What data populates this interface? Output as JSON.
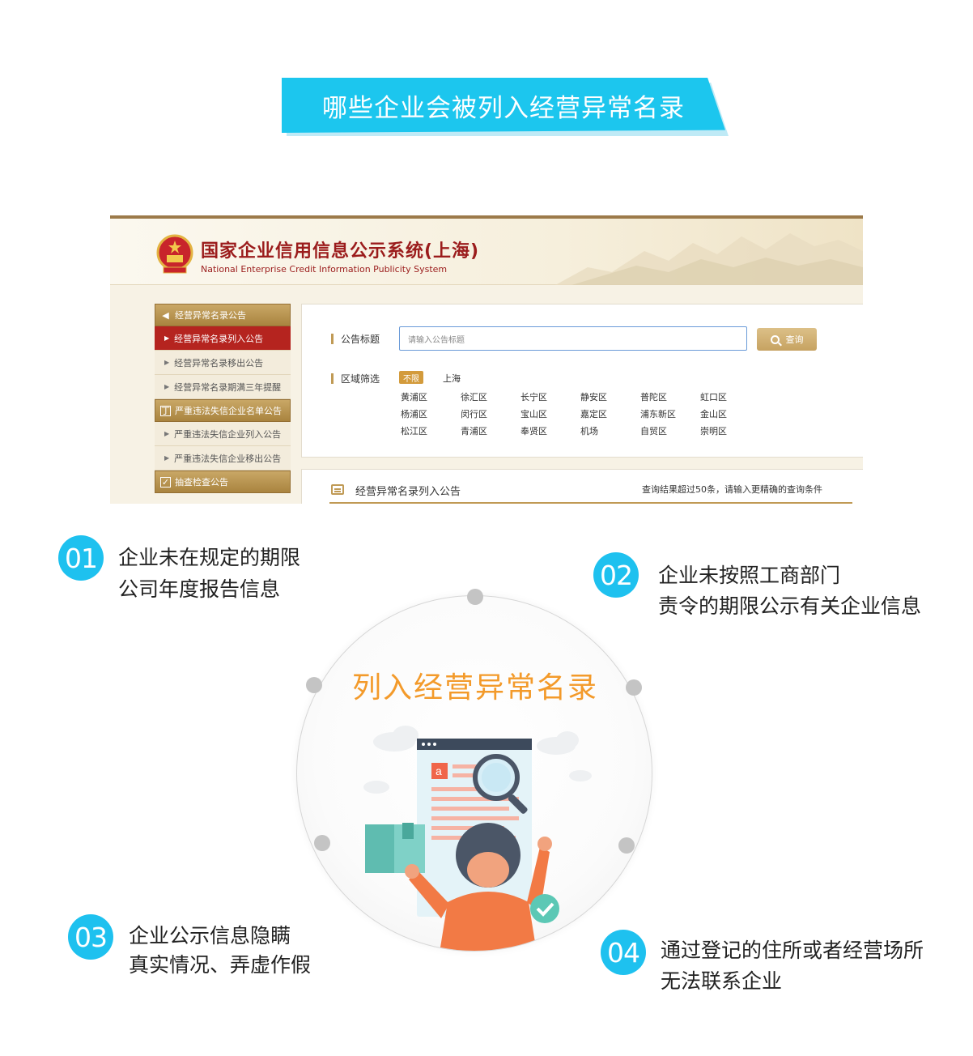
{
  "banner": {
    "title": "哪些企业会被列入经营异常名录"
  },
  "site": {
    "title": "国家企业信用信息公示系统(上海)",
    "subtitle": "National Enterprise Credit Information Publicity System",
    "sidebar": {
      "group1": "经营异常名录公告",
      "items1": [
        "经营异常名录列入公告",
        "经营异常名录移出公告",
        "经营异常名录期满三年提醒"
      ],
      "group2": "严重违法失信企业名单公告",
      "items2": [
        "严重违法失信企业列入公告",
        "严重违法失信企业移出公告"
      ],
      "group3": "抽查检查公告"
    },
    "search": {
      "title_label": "公告标题",
      "placeholder": "请输入公告标题",
      "button": "查询",
      "region_label": "区域筛选",
      "unlimited": "不限",
      "region": "上海",
      "districts": [
        [
          "黄浦区",
          "徐汇区",
          "长宁区",
          "静安区",
          "普陀区",
          "虹口区"
        ],
        [
          "杨浦区",
          "闵行区",
          "宝山区",
          "嘉定区",
          "浦东新区",
          "金山区"
        ],
        [
          "松江区",
          "青浦区",
          "奉贤区",
          "机场",
          "自贸区",
          "崇明区"
        ]
      ]
    },
    "results": {
      "title": "经营异常名录列入公告",
      "note": "查询结果超过50条，请输入更精确的查询条件"
    }
  },
  "center": {
    "title": "列入经营异常名录"
  },
  "points": [
    {
      "num": "01",
      "lines": [
        "企业未在规定的期限",
        "公司年度报告信息"
      ]
    },
    {
      "num": "02",
      "lines": [
        "企业未按照工商部门",
        "责令的期限公示有关企业信息"
      ]
    },
    {
      "num": "03",
      "lines": [
        "企业公示信息隐瞒",
        "真实情况、弄虚作假"
      ]
    },
    {
      "num": "04",
      "lines": [
        "通过登记的住所或者经营场所",
        "无法联系企业"
      ]
    }
  ],
  "colors": {
    "accent": "#1ec1ef",
    "orange": "#f39a2a",
    "site_red": "#9b1c1c",
    "gold": "#c09a55"
  },
  "icons": [
    "speaker-icon",
    "badge-icon",
    "checkbox-icon",
    "search-icon",
    "message-icon",
    "national-emblem-icon",
    "magnifier-icon"
  ]
}
